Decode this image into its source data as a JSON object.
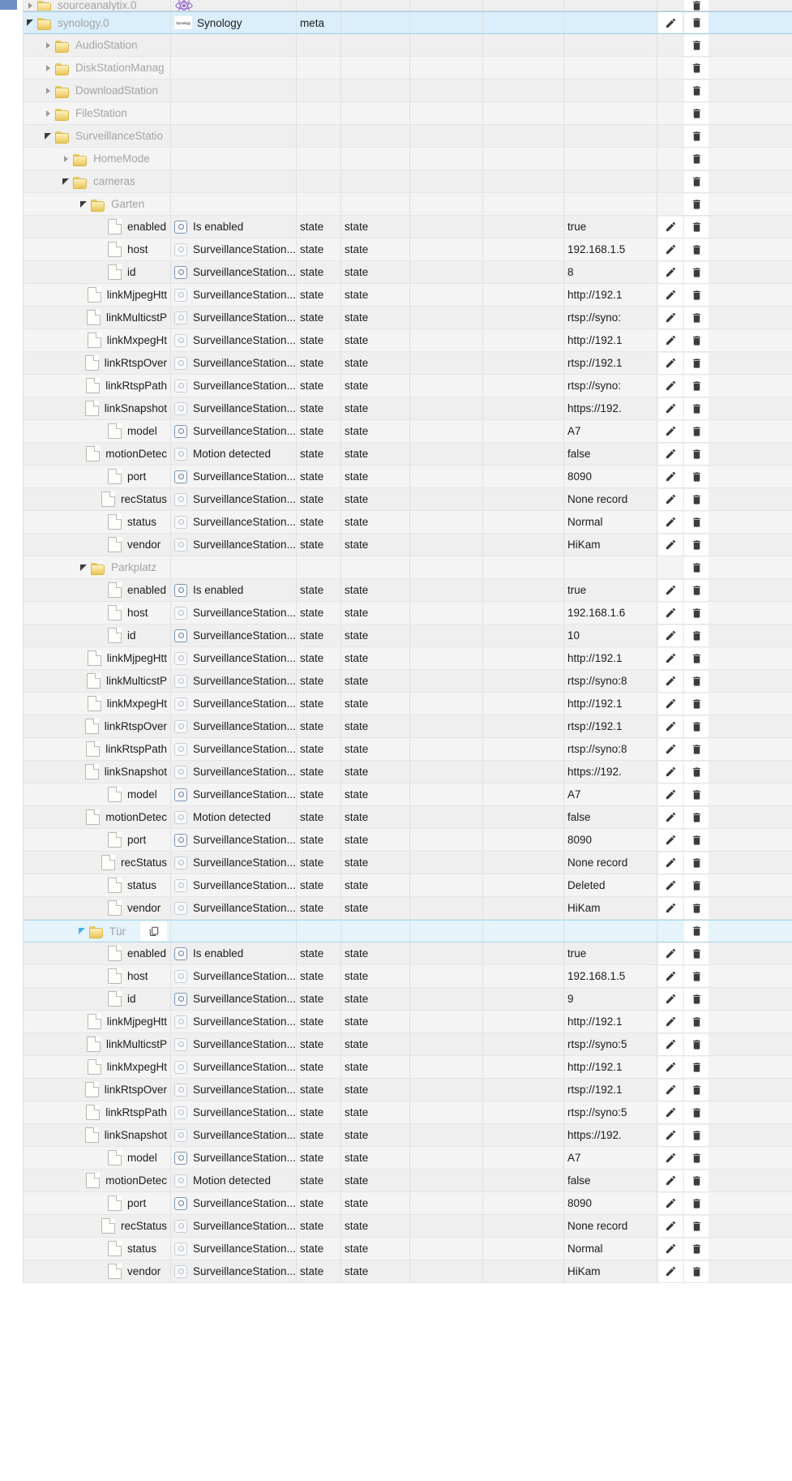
{
  "app": {
    "view": "object-tree",
    "colors": {
      "selected_row": "#daeefb",
      "selected_border": "#9ecfe8",
      "row_bg": "#efefef",
      "row_alt_bg": "#f4f4f4",
      "grid_line": "#e0e0e0",
      "tree_label": "#a4a4a4",
      "leaf_label": "#1b1b1b",
      "folder_yellow": "#e9c65c",
      "gutter_chip": "#6f8fc4"
    }
  },
  "icons": {
    "expand_collapsed": "chevron-right-icon",
    "expand_expanded": "chevron-down-icon",
    "folder": "folder-icon",
    "document": "document-icon",
    "state": "state-circle-icon",
    "edit": "pencil-icon",
    "delete": "trash-icon",
    "copy": "copy-icon",
    "synology_logo": "synology-logo-icon",
    "atom": "atom-icon"
  },
  "labels": {
    "synology_logo_text": "Synology",
    "copy_title": "Copy",
    "edit_title": "Edit",
    "delete_title": "Delete"
  },
  "rows": [
    {
      "kind": "tree",
      "depth": 0,
      "clipped": true,
      "name": "sourceanalytix.0",
      "expander": "collapsed",
      "title": "",
      "icon": "atom",
      "role": "",
      "room": "",
      "func": "",
      "value": "",
      "edit": false,
      "del": true,
      "selected": false
    },
    {
      "kind": "tree",
      "depth": 0,
      "name": "synology.0",
      "expander": "expanded",
      "title": "Synology",
      "icon": "synology",
      "role": "meta",
      "room": "",
      "func": "",
      "value": "",
      "edit": true,
      "del": true,
      "selected": true
    },
    {
      "kind": "tree",
      "depth": 1,
      "name": "AudioStation",
      "expander": "collapsed",
      "title": "",
      "icon": "none",
      "role": "",
      "room": "",
      "func": "",
      "value": "",
      "edit": false,
      "del": true,
      "selected": false
    },
    {
      "kind": "tree",
      "depth": 1,
      "name": "DiskStationManag",
      "expander": "collapsed",
      "title": "",
      "icon": "none",
      "role": "",
      "room": "",
      "func": "",
      "value": "",
      "edit": false,
      "del": true,
      "selected": false
    },
    {
      "kind": "tree",
      "depth": 1,
      "name": "DownloadStation",
      "expander": "collapsed",
      "title": "",
      "icon": "none",
      "role": "",
      "room": "",
      "func": "",
      "value": "",
      "edit": false,
      "del": true,
      "selected": false
    },
    {
      "kind": "tree",
      "depth": 1,
      "name": "FileStation",
      "expander": "collapsed",
      "title": "",
      "icon": "none",
      "role": "",
      "room": "",
      "func": "",
      "value": "",
      "edit": false,
      "del": true,
      "selected": false
    },
    {
      "kind": "tree",
      "depth": 1,
      "name": "SurveillanceStatio",
      "expander": "expanded",
      "title": "",
      "icon": "none",
      "role": "",
      "room": "",
      "func": "",
      "value": "",
      "edit": false,
      "del": true,
      "selected": false
    },
    {
      "kind": "tree",
      "depth": 2,
      "name": "HomeMode",
      "expander": "collapsed",
      "title": "",
      "icon": "none",
      "role": "",
      "room": "",
      "func": "",
      "value": "",
      "edit": false,
      "del": true,
      "selected": false
    },
    {
      "kind": "tree",
      "depth": 2,
      "name": "cameras",
      "expander": "expanded",
      "title": "",
      "icon": "none",
      "role": "",
      "room": "",
      "func": "",
      "value": "",
      "edit": false,
      "del": true,
      "selected": false
    },
    {
      "kind": "tree",
      "depth": 3,
      "name": "Garten",
      "expander": "expanded",
      "title": "",
      "icon": "none",
      "role": "",
      "room": "",
      "func": "",
      "value": "",
      "edit": false,
      "del": true,
      "selected": false
    },
    {
      "kind": "leaf",
      "depth": 4,
      "name": "enabled",
      "title": "Is enabled",
      "state_dim": false,
      "role": "state",
      "room": "state",
      "func": "",
      "value": "true",
      "edit": true,
      "del": true
    },
    {
      "kind": "leaf",
      "depth": 4,
      "name": "host",
      "title": "SurveillanceStation....",
      "state_dim": true,
      "role": "state",
      "room": "state",
      "func": "",
      "value": "192.168.1.5",
      "edit": true,
      "del": true
    },
    {
      "kind": "leaf",
      "depth": 4,
      "name": "id",
      "title": "SurveillanceStation....",
      "state_dim": false,
      "role": "state",
      "room": "state",
      "func": "",
      "value": "8",
      "edit": true,
      "del": true
    },
    {
      "kind": "leaf",
      "depth": 4,
      "name": "linkMjpegHtt",
      "title": "SurveillanceStation....",
      "state_dim": true,
      "role": "state",
      "room": "state",
      "func": "",
      "value": "http://192.1",
      "edit": true,
      "del": true
    },
    {
      "kind": "leaf",
      "depth": 4,
      "name": "linkMulticstP",
      "title": "SurveillanceStation....",
      "state_dim": true,
      "role": "state",
      "room": "state",
      "func": "",
      "value": "rtsp://syno:",
      "edit": true,
      "del": true
    },
    {
      "kind": "leaf",
      "depth": 4,
      "name": "linkMxpegHt",
      "title": "SurveillanceStation....",
      "state_dim": true,
      "role": "state",
      "room": "state",
      "func": "",
      "value": "http://192.1",
      "edit": true,
      "del": true
    },
    {
      "kind": "leaf",
      "depth": 4,
      "name": "linkRtspOver",
      "title": "SurveillanceStation....",
      "state_dim": true,
      "role": "state",
      "room": "state",
      "func": "",
      "value": "rtsp://192.1",
      "edit": true,
      "del": true
    },
    {
      "kind": "leaf",
      "depth": 4,
      "name": "linkRtspPath",
      "title": "SurveillanceStation....",
      "state_dim": true,
      "role": "state",
      "room": "state",
      "func": "",
      "value": "rtsp://syno:",
      "edit": true,
      "del": true
    },
    {
      "kind": "leaf",
      "depth": 4,
      "name": "linkSnapshot",
      "title": "SurveillanceStation....",
      "state_dim": true,
      "role": "state",
      "room": "state",
      "func": "",
      "value": "https://192.",
      "edit": true,
      "del": true
    },
    {
      "kind": "leaf",
      "depth": 4,
      "name": "model",
      "title": "SurveillanceStation....",
      "state_dim": false,
      "role": "state",
      "room": "state",
      "func": "",
      "value": "A7",
      "edit": true,
      "del": true
    },
    {
      "kind": "leaf",
      "depth": 4,
      "name": "motionDetec",
      "title": "Motion detected",
      "state_dim": true,
      "role": "state",
      "room": "state",
      "func": "",
      "value": "false",
      "edit": true,
      "del": true
    },
    {
      "kind": "leaf",
      "depth": 4,
      "name": "port",
      "title": "SurveillanceStation....",
      "state_dim": false,
      "role": "state",
      "room": "state",
      "func": "",
      "value": "8090",
      "edit": true,
      "del": true
    },
    {
      "kind": "leaf",
      "depth": 4,
      "name": "recStatus",
      "title": "SurveillanceStation....",
      "state_dim": true,
      "role": "state",
      "room": "state",
      "func": "",
      "value": "None record",
      "edit": true,
      "del": true
    },
    {
      "kind": "leaf",
      "depth": 4,
      "name": "status",
      "title": "SurveillanceStation....",
      "state_dim": true,
      "role": "state",
      "room": "state",
      "func": "",
      "value": "Normal",
      "edit": true,
      "del": true
    },
    {
      "kind": "leaf",
      "depth": 4,
      "name": "vendor",
      "title": "SurveillanceStation....",
      "state_dim": true,
      "role": "state",
      "room": "state",
      "func": "",
      "value": "HiKam",
      "edit": true,
      "del": true
    },
    {
      "kind": "tree",
      "depth": 3,
      "name": "Parkplatz",
      "expander": "expanded",
      "title": "",
      "icon": "none",
      "role": "",
      "room": "",
      "func": "",
      "value": "",
      "edit": false,
      "del": true,
      "selected": false
    },
    {
      "kind": "leaf",
      "depth": 4,
      "name": "enabled",
      "title": "Is enabled",
      "state_dim": false,
      "role": "state",
      "room": "state",
      "func": "",
      "value": "true",
      "edit": true,
      "del": true
    },
    {
      "kind": "leaf",
      "depth": 4,
      "name": "host",
      "title": "SurveillanceStation....",
      "state_dim": true,
      "role": "state",
      "room": "state",
      "func": "",
      "value": "192.168.1.6",
      "edit": true,
      "del": true
    },
    {
      "kind": "leaf",
      "depth": 4,
      "name": "id",
      "title": "SurveillanceStation....",
      "state_dim": false,
      "role": "state",
      "room": "state",
      "func": "",
      "value": "10",
      "edit": true,
      "del": true
    },
    {
      "kind": "leaf",
      "depth": 4,
      "name": "linkMjpegHtt",
      "title": "SurveillanceStation....",
      "state_dim": true,
      "role": "state",
      "room": "state",
      "func": "",
      "value": "http://192.1",
      "edit": true,
      "del": true
    },
    {
      "kind": "leaf",
      "depth": 4,
      "name": "linkMulticstP",
      "title": "SurveillanceStation....",
      "state_dim": true,
      "role": "state",
      "room": "state",
      "func": "",
      "value": "rtsp://syno:8",
      "edit": true,
      "del": true
    },
    {
      "kind": "leaf",
      "depth": 4,
      "name": "linkMxpegHt",
      "title": "SurveillanceStation....",
      "state_dim": true,
      "role": "state",
      "room": "state",
      "func": "",
      "value": "http://192.1",
      "edit": true,
      "del": true
    },
    {
      "kind": "leaf",
      "depth": 4,
      "name": "linkRtspOver",
      "title": "SurveillanceStation....",
      "state_dim": true,
      "role": "state",
      "room": "state",
      "func": "",
      "value": "rtsp://192.1",
      "edit": true,
      "del": true
    },
    {
      "kind": "leaf",
      "depth": 4,
      "name": "linkRtspPath",
      "title": "SurveillanceStation....",
      "state_dim": true,
      "role": "state",
      "room": "state",
      "func": "",
      "value": "rtsp://syno:8",
      "edit": true,
      "del": true
    },
    {
      "kind": "leaf",
      "depth": 4,
      "name": "linkSnapshot",
      "title": "SurveillanceStation....",
      "state_dim": true,
      "role": "state",
      "room": "state",
      "func": "",
      "value": "https://192.",
      "edit": true,
      "del": true
    },
    {
      "kind": "leaf",
      "depth": 4,
      "name": "model",
      "title": "SurveillanceStation....",
      "state_dim": false,
      "role": "state",
      "room": "state",
      "func": "",
      "value": "A7",
      "edit": true,
      "del": true
    },
    {
      "kind": "leaf",
      "depth": 4,
      "name": "motionDetec",
      "title": "Motion detected",
      "state_dim": true,
      "role": "state",
      "room": "state",
      "func": "",
      "value": "false",
      "edit": true,
      "del": true
    },
    {
      "kind": "leaf",
      "depth": 4,
      "name": "port",
      "title": "SurveillanceStation....",
      "state_dim": false,
      "role": "state",
      "room": "state",
      "func": "",
      "value": "8090",
      "edit": true,
      "del": true
    },
    {
      "kind": "leaf",
      "depth": 4,
      "name": "recStatus",
      "title": "SurveillanceStation....",
      "state_dim": true,
      "role": "state",
      "room": "state",
      "func": "",
      "value": "None record",
      "edit": true,
      "del": true
    },
    {
      "kind": "leaf",
      "depth": 4,
      "name": "status",
      "title": "SurveillanceStation....",
      "state_dim": true,
      "role": "state",
      "room": "state",
      "func": "",
      "value": "Deleted",
      "edit": true,
      "del": true
    },
    {
      "kind": "leaf",
      "depth": 4,
      "name": "vendor",
      "title": "SurveillanceStation....",
      "state_dim": true,
      "role": "state",
      "room": "state",
      "func": "",
      "value": "HiKam",
      "edit": true,
      "del": true
    },
    {
      "kind": "tree",
      "depth": 3,
      "name": "Tür",
      "expander": "expanded-blue",
      "title": "",
      "icon": "none",
      "role": "",
      "room": "",
      "func": "",
      "value": "",
      "edit": false,
      "del": true,
      "selected": "light",
      "copy": true
    },
    {
      "kind": "leaf",
      "depth": 4,
      "name": "enabled",
      "title": "Is enabled",
      "state_dim": false,
      "role": "state",
      "room": "state",
      "func": "",
      "value": "true",
      "edit": true,
      "del": true
    },
    {
      "kind": "leaf",
      "depth": 4,
      "name": "host",
      "title": "SurveillanceStation....",
      "state_dim": true,
      "role": "state",
      "room": "state",
      "func": "",
      "value": "192.168.1.5",
      "edit": true,
      "del": true
    },
    {
      "kind": "leaf",
      "depth": 4,
      "name": "id",
      "title": "SurveillanceStation....",
      "state_dim": false,
      "role": "state",
      "room": "state",
      "func": "",
      "value": "9",
      "edit": true,
      "del": true
    },
    {
      "kind": "leaf",
      "depth": 4,
      "name": "linkMjpegHtt",
      "title": "SurveillanceStation....",
      "state_dim": true,
      "role": "state",
      "room": "state",
      "func": "",
      "value": "http://192.1",
      "edit": true,
      "del": true
    },
    {
      "kind": "leaf",
      "depth": 4,
      "name": "linkMulticstP",
      "title": "SurveillanceStation....",
      "state_dim": true,
      "role": "state",
      "room": "state",
      "func": "",
      "value": "rtsp://syno:5",
      "edit": true,
      "del": true
    },
    {
      "kind": "leaf",
      "depth": 4,
      "name": "linkMxpegHt",
      "title": "SurveillanceStation....",
      "state_dim": true,
      "role": "state",
      "room": "state",
      "func": "",
      "value": "http://192.1",
      "edit": true,
      "del": true
    },
    {
      "kind": "leaf",
      "depth": 4,
      "name": "linkRtspOver",
      "title": "SurveillanceStation....",
      "state_dim": true,
      "role": "state",
      "room": "state",
      "func": "",
      "value": "rtsp://192.1",
      "edit": true,
      "del": true
    },
    {
      "kind": "leaf",
      "depth": 4,
      "name": "linkRtspPath",
      "title": "SurveillanceStation....",
      "state_dim": true,
      "role": "state",
      "room": "state",
      "func": "",
      "value": "rtsp://syno:5",
      "edit": true,
      "del": true
    },
    {
      "kind": "leaf",
      "depth": 4,
      "name": "linkSnapshot",
      "title": "SurveillanceStation....",
      "state_dim": true,
      "role": "state",
      "room": "state",
      "func": "",
      "value": "https://192.",
      "edit": true,
      "del": true
    },
    {
      "kind": "leaf",
      "depth": 4,
      "name": "model",
      "title": "SurveillanceStation....",
      "state_dim": false,
      "role": "state",
      "room": "state",
      "func": "",
      "value": "A7",
      "edit": true,
      "del": true
    },
    {
      "kind": "leaf",
      "depth": 4,
      "name": "motionDetec",
      "title": "Motion detected",
      "state_dim": true,
      "role": "state",
      "room": "state",
      "func": "",
      "value": "false",
      "edit": true,
      "del": true
    },
    {
      "kind": "leaf",
      "depth": 4,
      "name": "port",
      "title": "SurveillanceStation....",
      "state_dim": false,
      "role": "state",
      "room": "state",
      "func": "",
      "value": "8090",
      "edit": true,
      "del": true
    },
    {
      "kind": "leaf",
      "depth": 4,
      "name": "recStatus",
      "title": "SurveillanceStation....",
      "state_dim": true,
      "role": "state",
      "room": "state",
      "func": "",
      "value": "None record",
      "edit": true,
      "del": true
    },
    {
      "kind": "leaf",
      "depth": 4,
      "name": "status",
      "title": "SurveillanceStation....",
      "state_dim": true,
      "role": "state",
      "room": "state",
      "func": "",
      "value": "Normal",
      "edit": true,
      "del": true
    },
    {
      "kind": "leaf",
      "depth": 4,
      "name": "vendor",
      "title": "SurveillanceStation....",
      "state_dim": true,
      "role": "state",
      "room": "state",
      "func": "",
      "value": "HiKam",
      "edit": true,
      "del": true
    }
  ]
}
